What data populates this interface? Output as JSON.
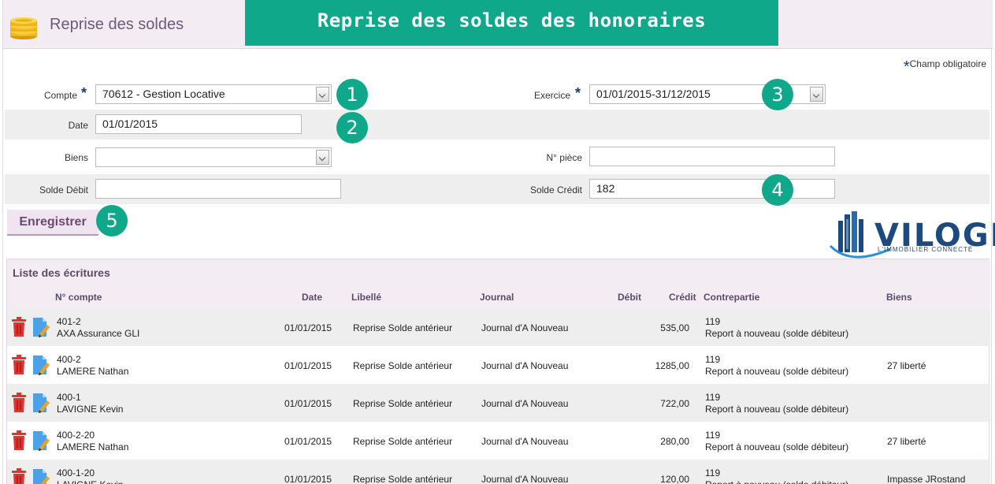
{
  "header": {
    "title": "Reprise des soldes",
    "banner": "Reprise des soldes des honoraires",
    "icon": "coins-icon"
  },
  "form": {
    "mandatory_note": "Champ obligatoire",
    "compte_label": "Compte",
    "compte_value": "70612 - Gestion Locative",
    "exercice_label": "Exercice",
    "exercice_value": "01/01/2015-31/12/2015",
    "date_label": "Date",
    "date_value": "01/01/2015",
    "biens_label": "Biens",
    "biens_value": "",
    "piece_label": "N° pièce",
    "piece_value": "",
    "solde_debit_label": "Solde Débit",
    "solde_debit_value": "",
    "solde_credit_label": "Solde Crédit",
    "solde_credit_value": "182",
    "save_label": "Enregistrer"
  },
  "badges": [
    "1",
    "2",
    "3",
    "4",
    "5"
  ],
  "logo": {
    "name": "VILOGI",
    "tagline": "L'IMMOBILIER CONNECTÉ"
  },
  "list": {
    "title": "Liste des écritures",
    "columns": {
      "compte": "N° compte",
      "date": "Date",
      "libelle": "Libellé",
      "journal": "Journal",
      "debit": "Débit",
      "credit": "Crédit",
      "contrepartie": "Contrepartie",
      "biens": "Biens"
    },
    "rows": [
      {
        "compte": "401-2",
        "nom": "AXA Assurance GLI",
        "date": "01/01/2015",
        "libelle": "Reprise Solde antérieur",
        "journal": "Journal d'A Nouveau",
        "debit": "",
        "credit": "535,00",
        "contre_num": "119",
        "contre_lib": "Report à nouveau (solde débiteur)",
        "biens": ""
      },
      {
        "compte": "400-2",
        "nom": "LAMERE Nathan",
        "date": "01/01/2015",
        "libelle": "Reprise Solde antérieur",
        "journal": "Journal d'A Nouveau",
        "debit": "",
        "credit": "1285,00",
        "contre_num": "119",
        "contre_lib": "Report à nouveau (solde débiteur)",
        "biens": "27 liberté"
      },
      {
        "compte": "400-1",
        "nom": "LAVIGNE Kevin",
        "date": "01/01/2015",
        "libelle": "Reprise Solde antérieur",
        "journal": "Journal d'A Nouveau",
        "debit": "",
        "credit": "722,00",
        "contre_num": "119",
        "contre_lib": "Report à nouveau (solde débiteur)",
        "biens": ""
      },
      {
        "compte": "400-2-20",
        "nom": "LAMERE Nathan",
        "date": "01/01/2015",
        "libelle": "Reprise Solde antérieur",
        "journal": "Journal d'A Nouveau",
        "debit": "",
        "credit": "280,00",
        "contre_num": "119",
        "contre_lib": "Report à nouveau (solde débiteur)",
        "biens": "27 liberté"
      },
      {
        "compte": "400-1-20",
        "nom": "LAVIGNE Kevin",
        "date": "01/01/2015",
        "libelle": "Reprise Solde antérieur",
        "journal": "Journal d'A Nouveau",
        "debit": "",
        "credit": "120,00",
        "contre_num": "119",
        "contre_lib": "Report à nouveau (solde débiteur)",
        "biens": "Impasse JRostand"
      }
    ],
    "row_icons": {
      "delete": "trash-icon",
      "edit": "edit-document-icon"
    }
  },
  "colors": {
    "accent": "#10a88a",
    "header_bg": "#f3ecf3",
    "title_text": "#5d4a68",
    "delete_red": "#e0322f",
    "edit_blue": "#4aa3e8",
    "logo_blue": "#1d4a7e"
  }
}
